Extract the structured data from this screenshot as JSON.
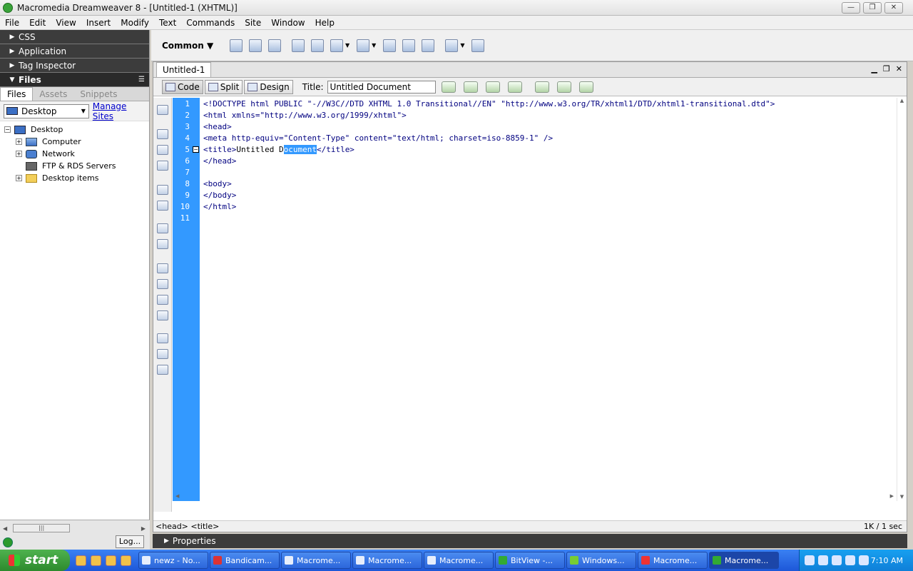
{
  "window": {
    "title": "Macromedia Dreamweaver 8 - [Untitled-1 (XHTML)]"
  },
  "menu": [
    "File",
    "Edit",
    "View",
    "Insert",
    "Modify",
    "Text",
    "Commands",
    "Site",
    "Window",
    "Help"
  ],
  "left_panel": {
    "panels": [
      "CSS",
      "Application",
      "Tag Inspector",
      "Files"
    ],
    "tabs": [
      "Files",
      "Assets",
      "Snippets"
    ],
    "site_select": "Desktop",
    "manage_sites": "Manage Sites",
    "tree": [
      {
        "label": "Desktop",
        "toggle": "−",
        "icon": "desktop-icon"
      },
      {
        "label": "Computer",
        "toggle": "+",
        "icon": "computer-icon"
      },
      {
        "label": "Network",
        "toggle": "+",
        "icon": "network-icon"
      },
      {
        "label": "FTP & RDS Servers",
        "toggle": "",
        "icon": "ftp-server-icon"
      },
      {
        "label": "Desktop items",
        "toggle": "+",
        "icon": "folder-icon"
      }
    ],
    "log_button": "Log..."
  },
  "insert_bar": {
    "category": "Common"
  },
  "document": {
    "tab": "Untitled-1",
    "views": [
      "Code",
      "Split",
      "Design"
    ],
    "title_label": "Title:",
    "title_value": "Untitled Document",
    "code_lines": [
      {
        "num": "1",
        "pre": "<!DOCTYPE html PUBLIC \"-//W3C//DTD XHTML 1.0 Transitional//EN\" \"http://www.w3.org/TR/xhtml1/DTD/xhtml1-transitional.dtd\">",
        "text": "",
        "sel": "",
        "post": ""
      },
      {
        "num": "2",
        "pre": "<html xmlns=\"http://www.w3.org/1999/xhtml\">",
        "text": "",
        "sel": "",
        "post": ""
      },
      {
        "num": "3",
        "pre": "<head>",
        "text": "",
        "sel": "",
        "post": ""
      },
      {
        "num": "4",
        "pre": "<meta http-equiv=\"Content-Type\" content=\"text/html; charset=iso-8859-1\" />",
        "text": "",
        "sel": "",
        "post": ""
      },
      {
        "num": "5",
        "pre": "<title>",
        "text": "Untitled D",
        "sel": "ocument",
        "post": "</title>"
      },
      {
        "num": "6",
        "pre": "</head>",
        "text": "",
        "sel": "",
        "post": ""
      },
      {
        "num": "7",
        "pre": "",
        "text": "",
        "sel": "",
        "post": ""
      },
      {
        "num": "8",
        "pre": "<body>",
        "text": "",
        "sel": "",
        "post": ""
      },
      {
        "num": "9",
        "pre": "</body>",
        "text": "",
        "sel": "",
        "post": ""
      },
      {
        "num": "10",
        "pre": "</html>",
        "text": "",
        "sel": "",
        "post": ""
      },
      {
        "num": "11",
        "pre": "",
        "text": "",
        "sel": "",
        "post": ""
      }
    ],
    "status_tags": "<head> <title>",
    "status_right": "1K / 1 sec"
  },
  "properties": "Properties",
  "taskbar": {
    "start": "start",
    "tasks": [
      {
        "label": "newz - No..."
      },
      {
        "label": "Bandicam..."
      },
      {
        "label": "Macrome..."
      },
      {
        "label": "Macrome..."
      },
      {
        "label": "Macrome..."
      },
      {
        "label": "BitView -..."
      },
      {
        "label": "Windows..."
      },
      {
        "label": "Macrome..."
      },
      {
        "label": "Macrome..."
      }
    ],
    "clock": "7:10 AM"
  },
  "colors": {
    "gutter": "#3399ff",
    "panel_header": "#3c3c3c",
    "taskbar": "#245edb"
  }
}
